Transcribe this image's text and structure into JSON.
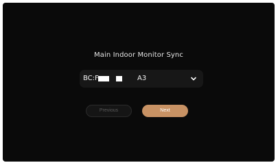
{
  "sync": {
    "title": "Main Indoor Monitor Sync",
    "device": {
      "prefix": "BC:F",
      "suffix": "A3",
      "dropdown_icon": "chevron-down-icon"
    }
  },
  "buttons": {
    "previous_label": "Previous",
    "next_label": "Next"
  },
  "colors": {
    "background": "#0a0a0a",
    "select_bg": "#171717",
    "accent": "#c89264",
    "disabled_text": "#5a5a5a"
  }
}
